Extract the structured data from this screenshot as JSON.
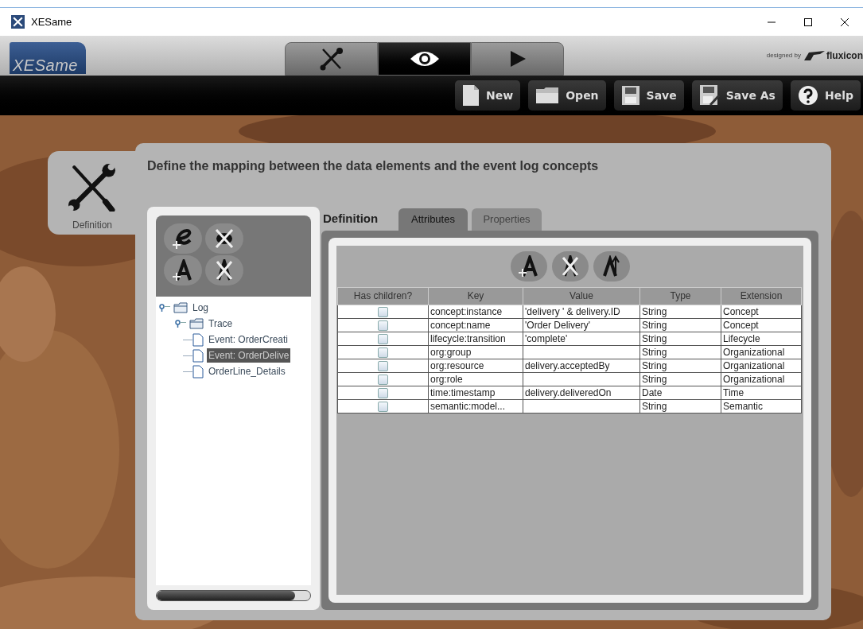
{
  "window": {
    "title": "XESame"
  },
  "header": {
    "logo": "XESame",
    "credit_prefix": "designed by",
    "credit_brand": "fluxicon"
  },
  "mode_tabs": [
    {
      "kind": "tools",
      "selected": false
    },
    {
      "kind": "eye",
      "selected": true
    },
    {
      "kind": "play",
      "selected": false
    }
  ],
  "toolbar": [
    {
      "kind": "new",
      "label": "New"
    },
    {
      "kind": "open",
      "label": "Open"
    },
    {
      "kind": "save",
      "label": "Save"
    },
    {
      "kind": "saveas",
      "label": "Save As"
    },
    {
      "kind": "help",
      "label": "Help"
    }
  ],
  "side_tab": {
    "label": "Definition",
    "selected": true
  },
  "heading": "Define the mapping between the data elements and the event log concepts",
  "tree": [
    {
      "label": "Log",
      "kind": "folder",
      "expanded": true,
      "selected": false,
      "children": [
        {
          "label": "Trace",
          "kind": "folder",
          "expanded": true,
          "selected": false,
          "children": [
            {
              "label": "Event: OrderCreati",
              "kind": "file",
              "selected": false
            },
            {
              "label": "Event: OrderDelive",
              "kind": "file",
              "selected": true
            },
            {
              "label": "OrderLine_Details",
              "kind": "file",
              "selected": false
            }
          ]
        }
      ]
    }
  ],
  "section_label": "Definition",
  "tabs": [
    {
      "label": "Attributes",
      "selected": true
    },
    {
      "label": "Properties",
      "selected": false
    }
  ],
  "table": {
    "columns": [
      "Has children?",
      "Key",
      "Value",
      "Type",
      "Extension"
    ],
    "rows": [
      {
        "checked": false,
        "key": "concept:instance",
        "value": "'delivery ' & delivery.ID",
        "type": "String",
        "extension": "Concept"
      },
      {
        "checked": false,
        "key": "concept:name",
        "value": "'Order Delivery'",
        "type": "String",
        "extension": "Concept"
      },
      {
        "checked": false,
        "key": "lifecycle:transition",
        "value": "'complete'",
        "type": "String",
        "extension": "Lifecycle"
      },
      {
        "checked": false,
        "key": "org:group",
        "type": "String",
        "extension": "Organizational"
      },
      {
        "checked": false,
        "key": "org:resource",
        "value": "delivery.acceptedBy",
        "type": "String",
        "extension": "Organizational"
      },
      {
        "checked": false,
        "key": "org:role",
        "type": "String",
        "extension": "Organizational"
      },
      {
        "checked": false,
        "key": "time:timestamp",
        "value": "delivery.deliveredOn",
        "type": "Date",
        "extension": "Time"
      },
      {
        "checked": false,
        "key": "semantic:model...",
        "type": "String",
        "extension": "Semantic"
      }
    ]
  }
}
